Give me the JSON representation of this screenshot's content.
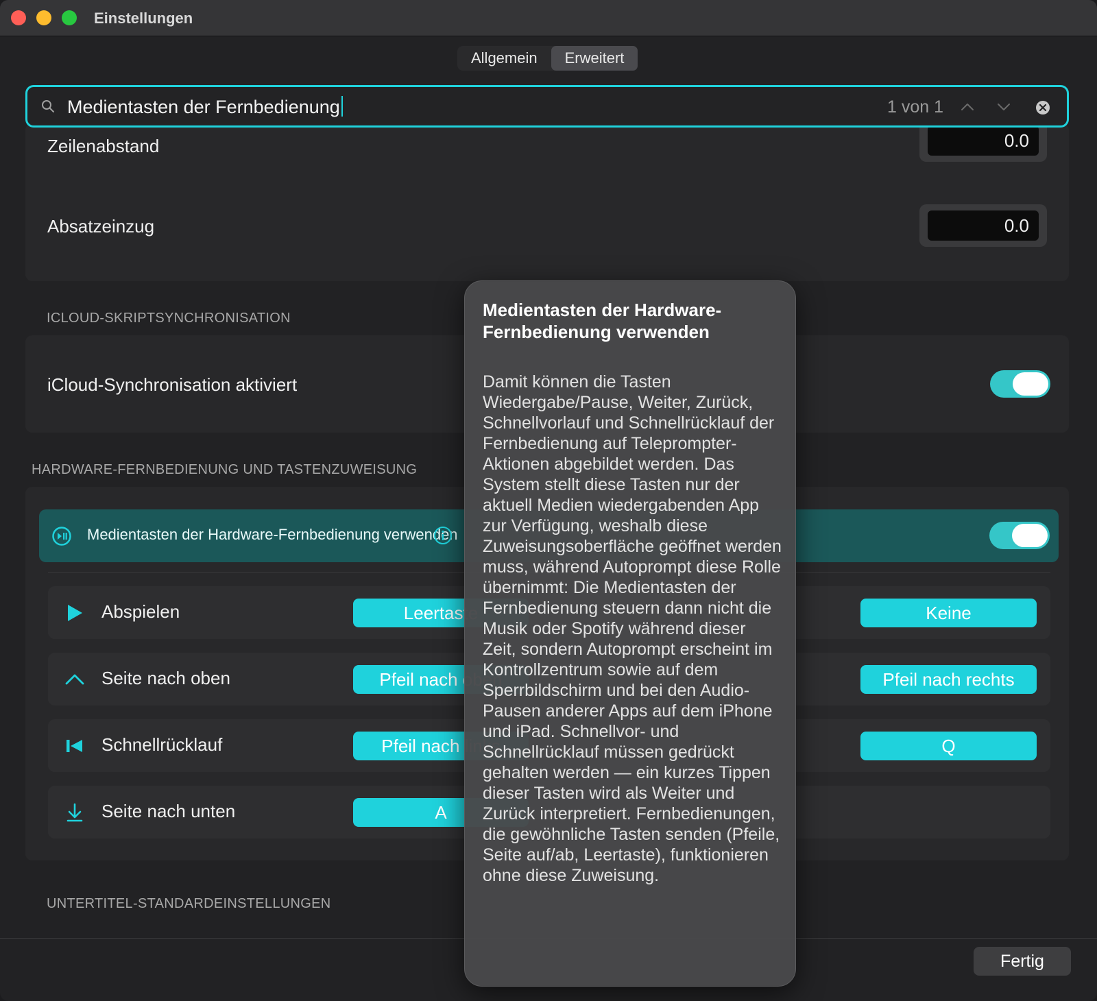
{
  "window": {
    "title": "Einstellungen"
  },
  "tabs": [
    {
      "label": "Allgemein"
    },
    {
      "label": "Erweitert"
    }
  ],
  "search": {
    "value": "Medientasten der Fernbedienung",
    "count": "1 von 1"
  },
  "spacing": {
    "line_spacing_label": "Zeilenabstand",
    "line_spacing_value": "0.0",
    "indent_label": "Absatzeinzug",
    "indent_value": "0.0"
  },
  "icloud": {
    "header": "ICLOUD-SKRIPTSYNCHRONISATION",
    "sync_label": "iCloud-Synchronisation aktiviert",
    "sync_enabled": true
  },
  "remote": {
    "header": "HARDWARE-FERNBEDIENUNG UND TASTENZUWEISUNG",
    "media_keys_label": "Medientasten der Hardware-Fernbedienung verwenden",
    "media_keys_enabled": true,
    "mappings": [
      {
        "label": "Abspielen",
        "icon": "play-icon",
        "key1": "Leertaste",
        "key2": "Keine"
      },
      {
        "label": "Seite nach oben",
        "icon": "chevron-up-icon",
        "key1": "Pfeil nach oben",
        "key2": "Pfeil nach rechts"
      },
      {
        "label": "Schnellrücklauf",
        "icon": "rewind-icon",
        "key1": "Pfeil nach links",
        "key2": "Q"
      },
      {
        "label": "Seite nach unten",
        "icon": "arrow-down-icon",
        "key1": "A",
        "key2": ""
      }
    ]
  },
  "subtitles": {
    "header": "UNTERTITEL-STANDARDEINSTELLUNGEN"
  },
  "footer": {
    "done_label": "Fertig"
  },
  "popover": {
    "title": "Medientasten der Hardware-Fernbedienung verwenden",
    "body": "Damit können die Tasten Wiedergabe/Pause, Weiter, Zurück, Schnellvorlauf und Schnellrücklauf der Fernbedienung auf Teleprompter-Aktionen abgebildet werden. Das System stellt diese Tasten nur der aktuell Medien wiedergabenden App zur Verfügung, weshalb diese Zuweisungsoberfläche geöffnet werden muss, während Autoprompt diese Rolle übernimmt: Die Medientasten der Fernbedienung steuern dann nicht die Musik oder Spotify während dieser Zeit, sondern Autoprompt erscheint im Kontrollzentrum sowie auf dem Sperrbildschirm und bei den Audio-Pausen anderer Apps auf dem iPhone und iPad. Schnellvor- und Schnellrücklauf müssen gedrückt gehalten werden — ein kurzes Tippen dieser Tasten wird als Weiter und Zurück interpretiert. Fernbedienungen, die gewöhnliche Tasten senden (Pfeile, Seite auf/ab, Leertaste), funktionieren ohne diese Zuweisung."
  },
  "colors": {
    "accent": "#1fd2dc",
    "toggle_on": "#35c6c8",
    "highlight_row": "#1b5859",
    "background": "#222224"
  }
}
